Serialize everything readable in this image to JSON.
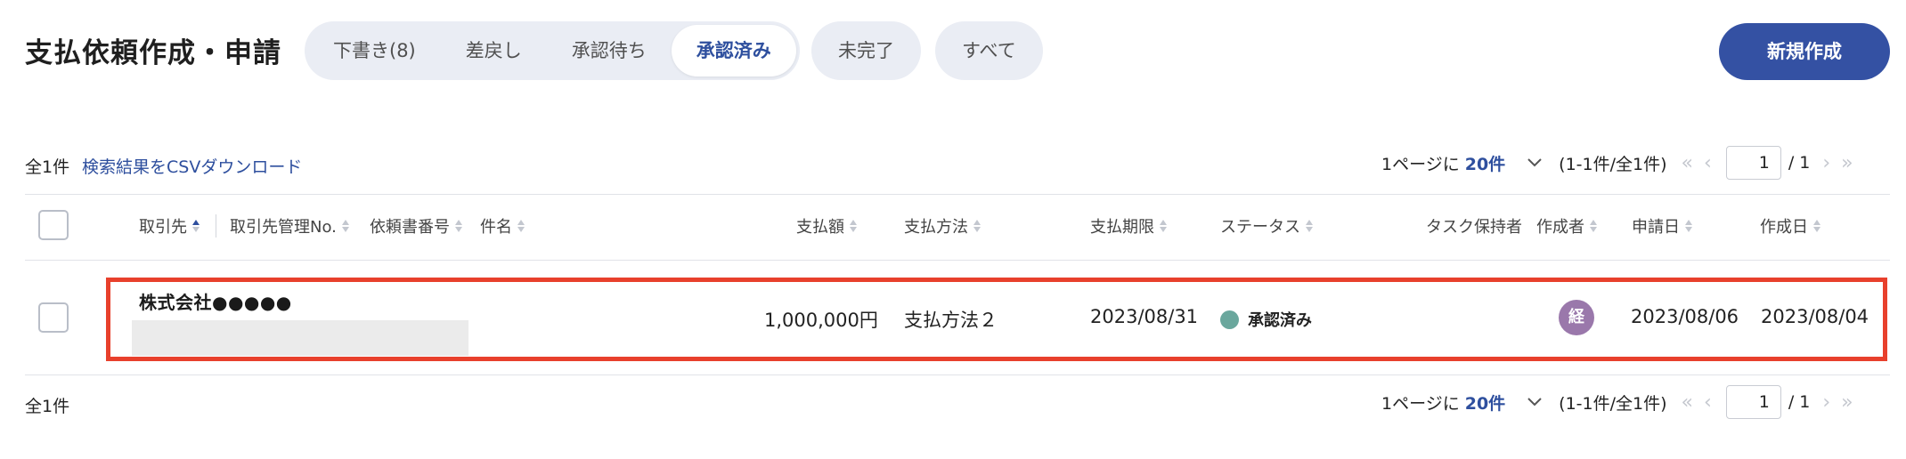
{
  "header": {
    "title": "支払依頼作成・申請",
    "tabs": [
      {
        "label": "下書き(8)"
      },
      {
        "label": "差戻し"
      },
      {
        "label": "承認待ち"
      },
      {
        "label": "承認済み"
      }
    ],
    "pills": [
      {
        "label": "未完了"
      },
      {
        "label": "すべて"
      }
    ],
    "new_button": "新規作成"
  },
  "summary": {
    "total": "全1件",
    "csv_link": "検索結果をCSVダウンロード"
  },
  "pagination": {
    "per_page_label": "1ページに",
    "per_page_value": "20件",
    "range": "(1-1件/全1件)",
    "current_page": "1",
    "total_pages": "/ 1"
  },
  "table": {
    "headers": {
      "vendor": "取引先",
      "vendor_code": "取引先管理No.",
      "request_no": "依頼書番号",
      "subject": "件名",
      "amount": "支払額",
      "method": "支払方法",
      "due": "支払期限",
      "status": "ステータス",
      "task_holder": "タスク保持者",
      "creator": "作成者",
      "applied": "申請日",
      "created": "作成日"
    },
    "rows": [
      {
        "vendor": "株式会社●●●●●",
        "amount": "1,000,000円",
        "method": "支払方法２",
        "due": "2023/08/31",
        "status": "承認済み",
        "creator_initial": "経",
        "applied": "2023/08/06",
        "created": "2023/08/04"
      }
    ]
  },
  "footer": {
    "total": "全1件"
  },
  "colors": {
    "accent": "#3451a3",
    "highlight": "#e8402c",
    "status_approved": "#6aa79d",
    "avatar": "#9a78ab"
  }
}
